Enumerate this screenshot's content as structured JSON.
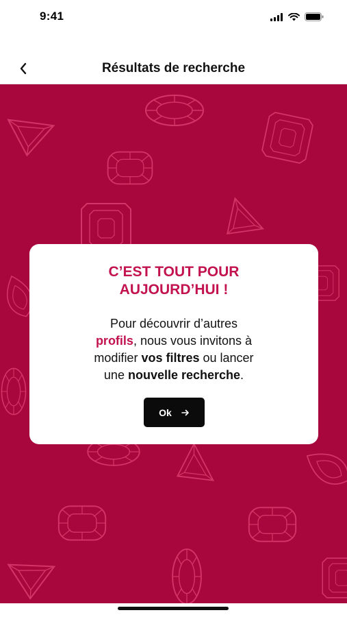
{
  "status_bar": {
    "time": "9:41",
    "icons": [
      "cellular-signal-icon",
      "wifi-icon",
      "battery-icon"
    ]
  },
  "header": {
    "back_icon": "chevron-left-icon",
    "title": "Résultats de recherche"
  },
  "background": {
    "color": "#a8073d",
    "pattern_icons": [
      "oval-gem-icon",
      "trillion-gem-icon",
      "cushion-gem-icon",
      "emerald-cut-gem-icon"
    ]
  },
  "modal": {
    "title_line1": "C’EST TOUT POUR",
    "title_line2": "AUJOURD’HUI !",
    "body": {
      "p1": "Pour découvrir d’autres",
      "b1": "profils",
      "p2": ", nous vous invitons à",
      "p3": "modifier ",
      "b2": "vos filtres",
      "p4": " ou lancer",
      "p5": "une ",
      "b3": "nouvelle recherche",
      "p6": "."
    },
    "button_label": "Ok",
    "button_icon": "arrow-right-icon"
  },
  "colors": {
    "accent": "#c2124f",
    "background": "#a8073d",
    "button": "#0b0b0b"
  }
}
